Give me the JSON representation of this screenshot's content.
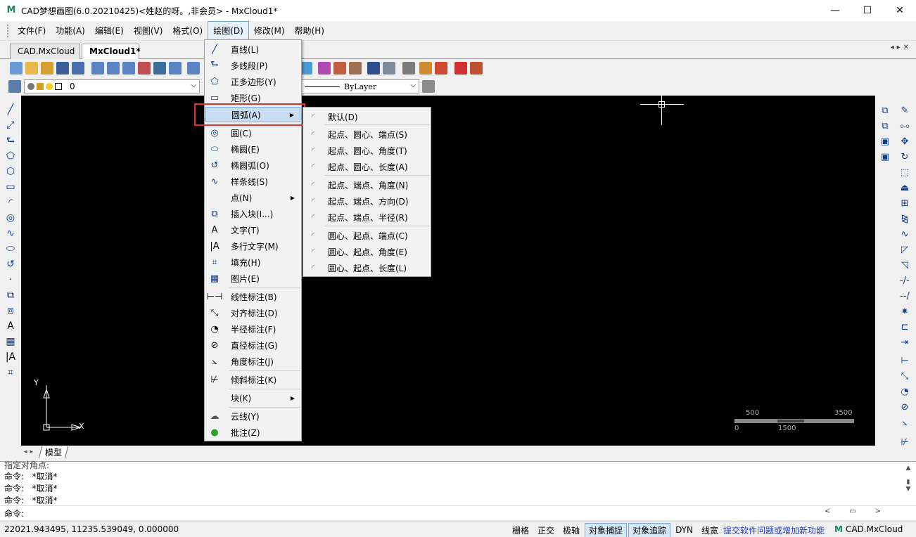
{
  "window": {
    "title": "CAD梦想画图(6.0.20210425)<姓赵的呀。,非会员> - MxCloud1*",
    "controls": {
      "minimize": "—",
      "maximize": "☐",
      "close": "✕"
    }
  },
  "menubar": [
    "文件(F)",
    "功能(A)",
    "编辑(E)",
    "视图(V)",
    "格式(O)",
    "绘图(D)",
    "修改(M)",
    "帮助(H)"
  ],
  "doc_tabs": [
    "CAD.MxCloud",
    "MxCloud1*"
  ],
  "layer": {
    "name": "0"
  },
  "linetype": {
    "value": "ByLayer"
  },
  "draw_menu": {
    "items": [
      {
        "label": "直线(L)",
        "icon": "line-icon"
      },
      {
        "label": "多线段(P)",
        "icon": "polyline-icon"
      },
      {
        "label": "正多边形(Y)",
        "icon": "polygon-icon"
      },
      {
        "label": "矩形(G)",
        "icon": "rectangle-icon"
      },
      {
        "label": "圆弧(A)",
        "icon": "arc-icon"
      },
      {
        "label": "圆(C)",
        "icon": "circle-icon"
      },
      {
        "label": "椭圆(E)",
        "icon": "ellipse-icon"
      },
      {
        "label": "椭圆弧(O)",
        "icon": "ellipse-arc-icon"
      },
      {
        "label": "样条线(S)",
        "icon": "spline-icon"
      },
      {
        "label": "点(N)",
        "icon": ""
      },
      {
        "label": "插入块(I...)",
        "icon": "insert-block-icon"
      },
      {
        "label": "文字(T)",
        "icon": "text-icon"
      },
      {
        "label": "多行文字(M)",
        "icon": "mtext-icon"
      },
      {
        "label": "填充(H)",
        "icon": "hatch-icon"
      },
      {
        "label": "图片(E)",
        "icon": "image-icon"
      },
      {
        "label": "线性标注(B)",
        "icon": "linear-dim-icon"
      },
      {
        "label": "对齐标注(D)",
        "icon": "aligned-dim-icon"
      },
      {
        "label": "半径标注(F)",
        "icon": "radius-dim-icon"
      },
      {
        "label": "直径标注(G)",
        "icon": "diameter-dim-icon"
      },
      {
        "label": "角度标注(J)",
        "icon": "angle-dim-icon"
      },
      {
        "label": "倾斜标注(K)",
        "icon": "oblique-dim-icon"
      },
      {
        "label": "块(K)",
        "icon": ""
      },
      {
        "label": "云线(Y)",
        "icon": "revcloud-icon"
      },
      {
        "label": "批注(Z)",
        "icon": "comment-icon"
      }
    ]
  },
  "arc_submenu": {
    "items": [
      "默认(D)",
      "起点、圆心、端点(S)",
      "起点、圆心、角度(T)",
      "起点、圆心、长度(A)",
      "起点、端点、角度(N)",
      "起点、端点、方向(D)",
      "起点、端点、半径(R)",
      "圆心、起点、端点(C)",
      "圆心、起点、角度(E)",
      "圆心、起点、长度(L)"
    ]
  },
  "canvas": {
    "ucs_x": "X",
    "ucs_y": "Y",
    "scale_labels": {
      "top_left": "500",
      "top_right": "3500",
      "bottom_left": "0",
      "bottom_mid": "1500"
    }
  },
  "layout_tabs": {
    "model": "模型"
  },
  "command": {
    "lines": [
      "指定对角点:",
      "命令:   *取消*",
      "命令:   *取消*",
      "命令:   *取消*"
    ],
    "prompt": "命令:"
  },
  "status": {
    "coords": "22021.943495,  11235.539049,  0.000000",
    "buttons": [
      {
        "label": "栅格",
        "on": false
      },
      {
        "label": "正交",
        "on": false
      },
      {
        "label": "极轴",
        "on": false
      },
      {
        "label": "对象捕捉",
        "on": true
      },
      {
        "label": "对象追踪",
        "on": true
      },
      {
        "label": "DYN",
        "on": false
      },
      {
        "label": "线宽",
        "on": false
      }
    ],
    "feedback": "提交软件问题或增加新功能",
    "brand": "CAD.MxCloud"
  },
  "colors": {
    "canvas": "#000000",
    "highlight": "#c9def5",
    "red_box": "#e03030",
    "link": "#1a3cc8"
  }
}
